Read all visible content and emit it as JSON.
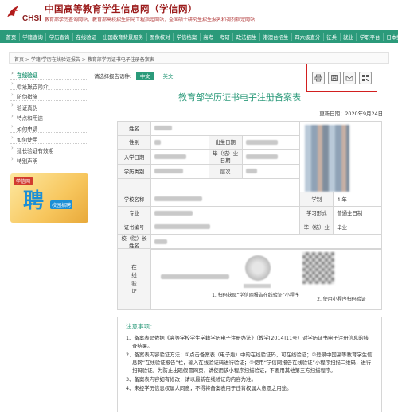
{
  "header": {
    "title": "中国高等教育学生信息网（学信网）",
    "subtitle": "教育部学历查询网站，教育部高校招生阳光工程指定网站，全国硕士研究生招生报名和调剂指定网站",
    "logo_text": "CHSI"
  },
  "nav": [
    "首页",
    "学籍查询",
    "学历查询",
    "在线验证",
    "出国教育背景服务",
    "图像校对",
    "学信档案",
    "高考",
    "考研",
    "政法招生",
    "港澳台招生",
    "四六级查分",
    "征兵",
    "就业",
    "学职平台",
    "日本频道"
  ],
  "breadcrumb": "首页 > 学籍/学历在线验证报告 > 教育部学历证书电子注册备案表",
  "sidebar": {
    "items": [
      "在线验证",
      "验证报告简介",
      "防伪措施",
      "验证真伪",
      "特点和用途",
      "如何申请",
      "如何使用",
      "延长验证有效期",
      "特别声明"
    ],
    "banner_tag": "学信网",
    "banner_big": "聘",
    "banner_small": "校园招聘"
  },
  "lang": {
    "label": "请选择报告语种:",
    "zh": "中文",
    "en": "英文"
  },
  "toolbar": {
    "icons": [
      "print-icon",
      "save-icon",
      "mail-icon",
      "qrcode-icon"
    ]
  },
  "doc": {
    "title": "教育部学历证书电子注册备案表",
    "update": "更新日期：2020年9月24日"
  },
  "table": {
    "name": "姓名",
    "gender": "性别",
    "birth": "出生日期",
    "enroll": "入学日期",
    "grad": "毕（结）业日期",
    "type": "学历类别",
    "level": "层次",
    "school": "学校名称",
    "system": "学制",
    "system_val": "4 年",
    "major": "专业",
    "form": "学习形式",
    "form_val": "普通全日制",
    "cert": "证书编号",
    "result": "毕（结）业",
    "result_val": "毕业",
    "principal": "校（院）长姓名"
  },
  "verify": {
    "label": [
      "在",
      "线",
      "验",
      "证"
    ],
    "cap1": "1.  扫码获取“学信网报告在线验证”小程序",
    "cap2": "2.  使用小程序扫码验证"
  },
  "notes": {
    "title": "注意事项：",
    "items": [
      "1、备案表是依据《高等学校学生学籍学历电子注册办法》（教学[2014]11号）对学历证书电子注册信息的核查结果。",
      "2、备案表内容验证方法：①点击备案表（电子版）中的在线验证码，可在线验证；②登录中国高等教育学生信息网“在线验证报告”栏，输入在线验证码进行验证；③使用“学信网报告在线验证”小程序扫描二维码，进行扫码验证。为防止出现假冒网页，请使用该小程序扫描验证，不要用其他第三方扫描程序。",
      "3、备案表内容如有修改，请以最新在线验证的内容为准。",
      "4、未经学历信息权属人同意，不得将备案表用于违背权属人意愿之用途。"
    ],
    "link": "教学[2014]11号"
  },
  "colors": {
    "brand": "#2b9a7a",
    "title_red": "#9b1b1b",
    "highlight": "#d21f1f"
  }
}
